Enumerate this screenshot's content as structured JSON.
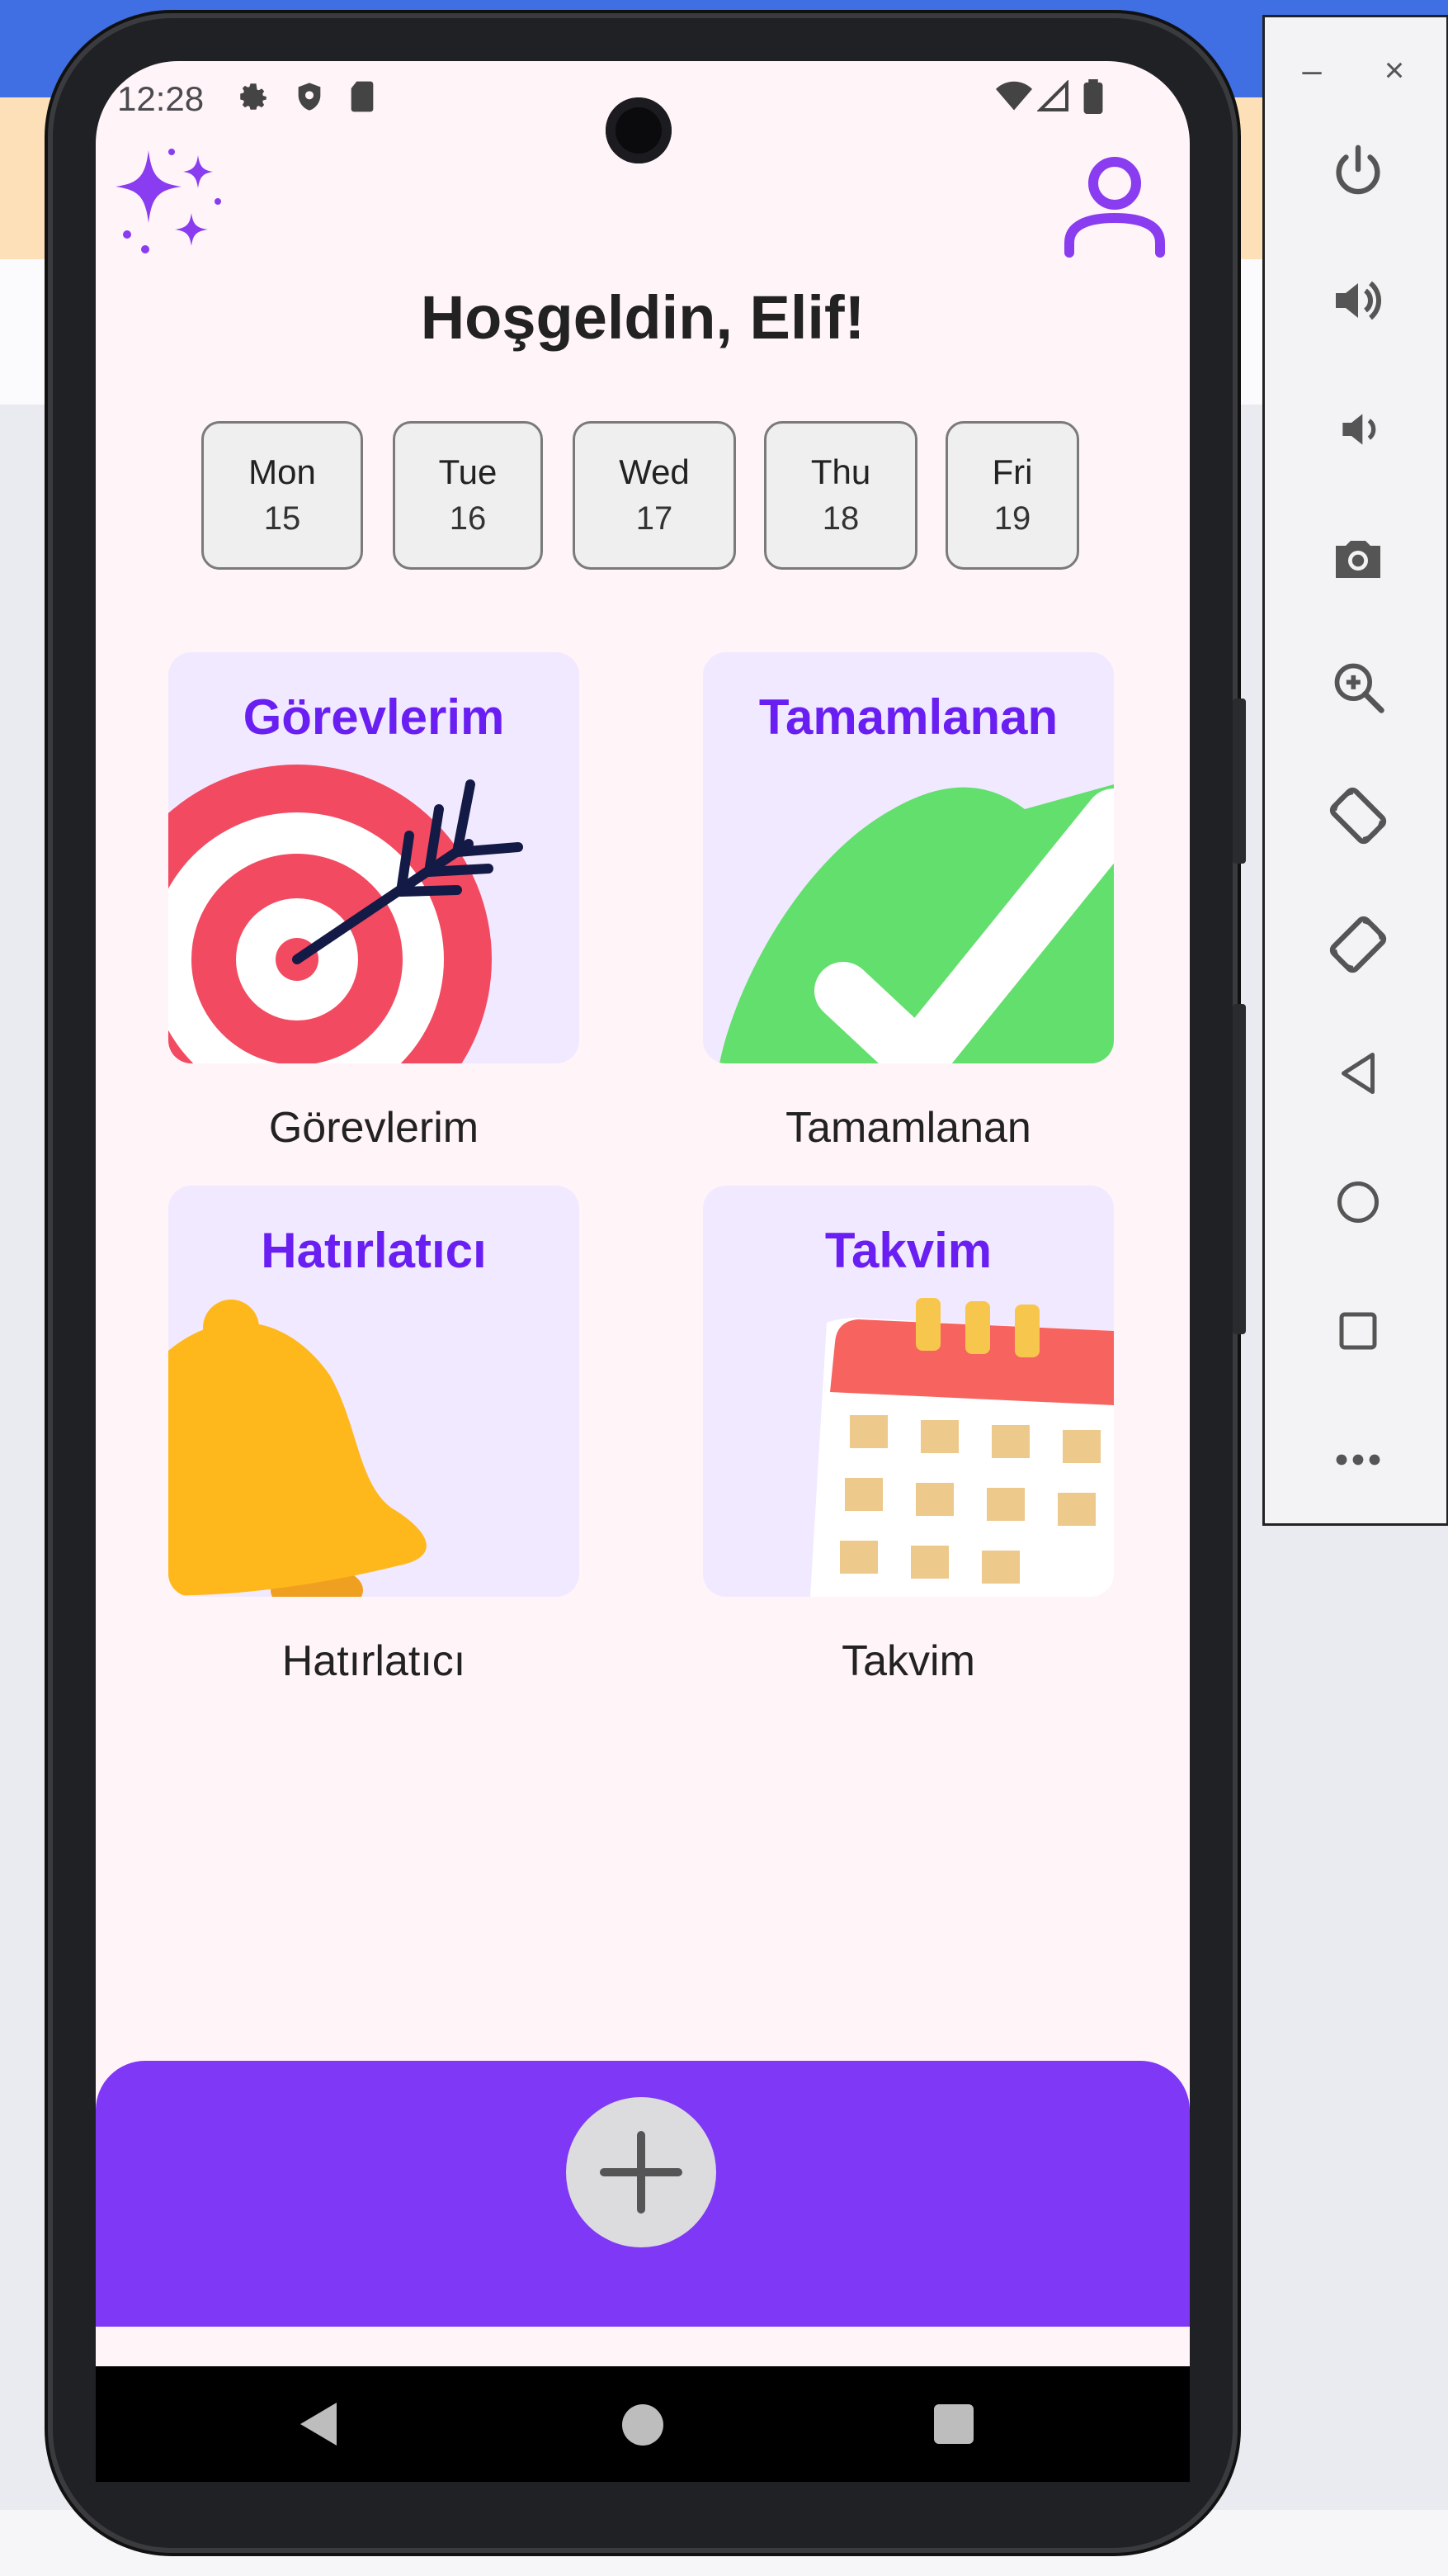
{
  "status_bar": {
    "time": "12:28"
  },
  "header": {
    "greeting": "Hoşgeldin, Elif!"
  },
  "days": [
    {
      "name": "Mon",
      "date": "15"
    },
    {
      "name": "Tue",
      "date": "16"
    },
    {
      "name": "Wed",
      "date": "17"
    },
    {
      "name": "Thu",
      "date": "18"
    },
    {
      "name": "Fri",
      "date": "19"
    }
  ],
  "tiles": [
    {
      "title": "Görevlerim",
      "label": "Görevlerim",
      "icon": "target-icon"
    },
    {
      "title": "Tamamlanan",
      "label": "Tamamlanan",
      "icon": "checkmark-icon"
    },
    {
      "title": "Hatırlatıcı",
      "label": "Hatırlatıcı",
      "icon": "bell-icon"
    },
    {
      "title": "Takvim",
      "label": "Takvim",
      "icon": "calendar-icon"
    }
  ],
  "bottom_bar": {
    "fab_icon": "plus-icon"
  },
  "colors": {
    "accent": "#7f38f6",
    "tile_title": "#6a1ff2",
    "tile_bg": "#f1e9ff",
    "screen_bg": "#fff4f8",
    "target_red": "#f24a61",
    "check_green": "#62df6c",
    "bell_yellow": "#ffb81c"
  },
  "emulator_toolbar": {
    "minimize": "–",
    "close": "×",
    "buttons": [
      "power-icon",
      "volume-up-icon",
      "volume-down-icon",
      "camera-icon",
      "zoom-icon",
      "rotate-left-icon",
      "rotate-right-icon",
      "back-icon",
      "home-icon",
      "overview-icon",
      "more-icon"
    ]
  }
}
